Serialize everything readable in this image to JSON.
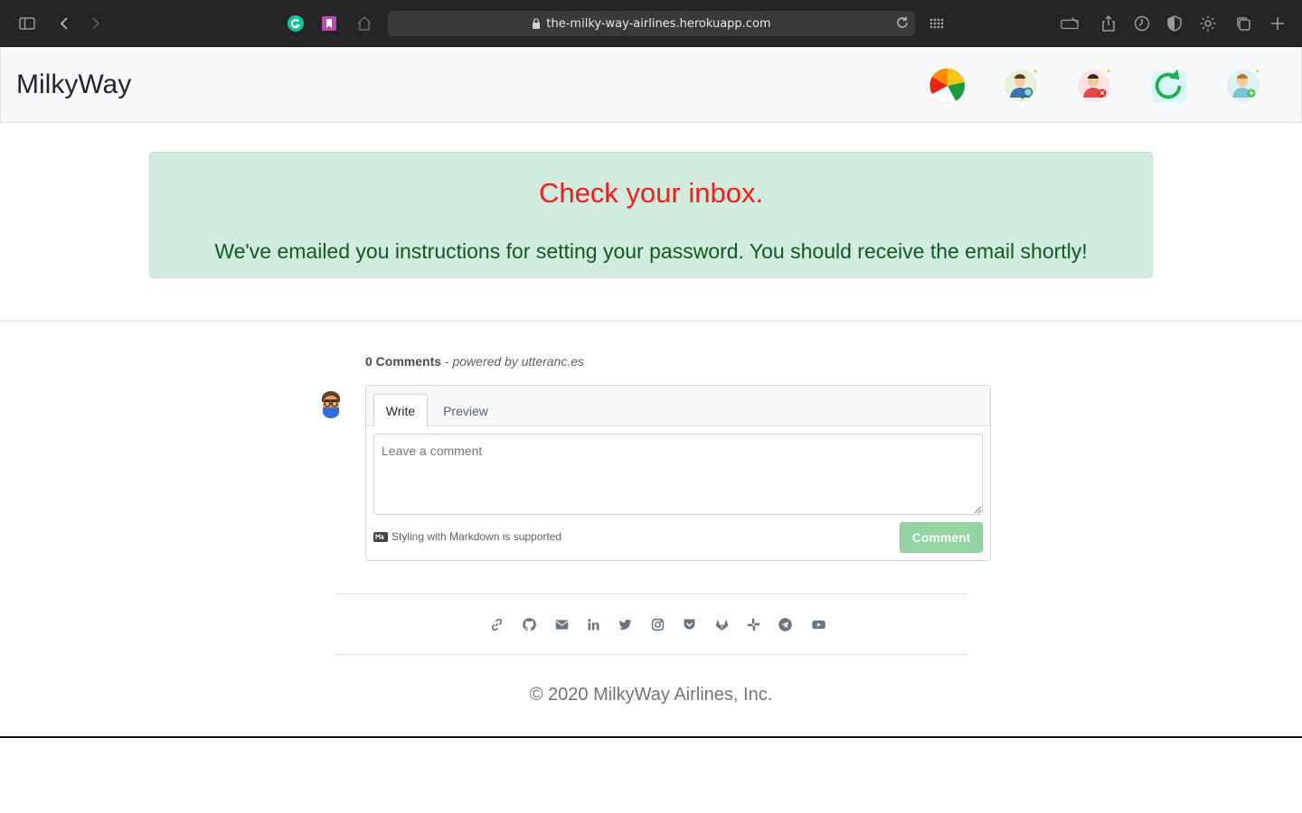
{
  "browser": {
    "url": "the-milky-way-airlines.herokuapp.com"
  },
  "navbar": {
    "brand": "MilkyWay",
    "icons": [
      "pie-chart-icon",
      "user-search-icon",
      "user-remove-icon",
      "refresh-icon",
      "user-add-icon"
    ]
  },
  "alert": {
    "title": "Check your inbox.",
    "message": "We've emailed you instructions for setting your password. You should receive the email shortly!",
    "title_color": "#ff1a1a",
    "message_color": "#0f5a22",
    "background": "#d1ecdc"
  },
  "comments": {
    "count_label": "0 Comments",
    "powered_by": "powered by utteranc.es",
    "tab_write": "Write",
    "tab_preview": "Preview",
    "placeholder": "Leave a comment",
    "markdown_note": "Styling with Markdown is supported",
    "submit_label": "Comment",
    "submit_color": "#94d3a2"
  },
  "footer": {
    "social_icons": [
      "link-icon",
      "github-icon",
      "email-icon",
      "linkedin-icon",
      "twitter-icon",
      "instagram-icon",
      "pocket-icon",
      "gitlab-icon",
      "slack-icon",
      "telegram-icon",
      "youtube-icon"
    ],
    "copyright": "© 2020 MilkyWay Airlines, Inc."
  }
}
